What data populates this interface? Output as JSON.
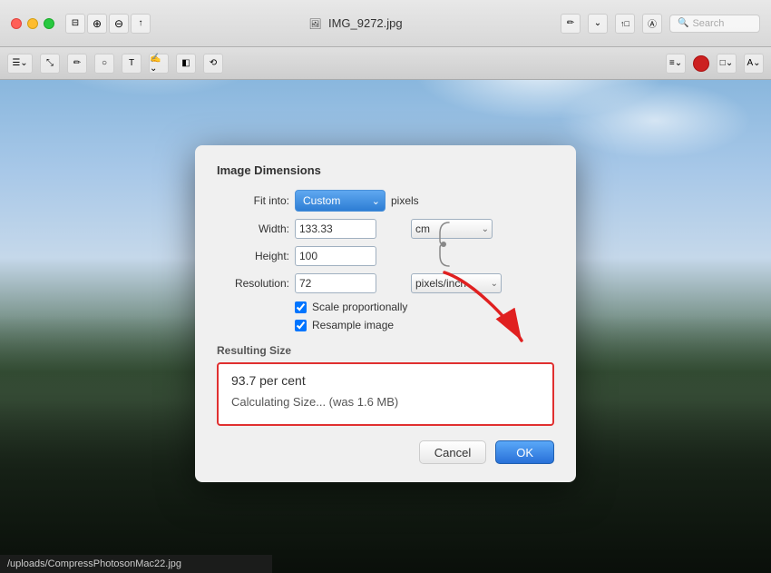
{
  "window": {
    "title": "IMG_9272.jpg",
    "title_icon": "🖼"
  },
  "titlebar": {
    "search_placeholder": "Search",
    "buttons": [
      "⊟",
      "⊡",
      "⧉"
    ]
  },
  "dialog": {
    "title": "Image Dimensions",
    "fit_into_label": "Fit into:",
    "fit_into_value": "Custom",
    "fit_into_unit": "pixels",
    "width_label": "Width:",
    "width_value": "133.33",
    "height_label": "Height:",
    "height_value": "100",
    "unit_value": "cm",
    "resolution_label": "Resolution:",
    "resolution_value": "72",
    "resolution_unit": "pixels/inch",
    "scale_label": "Scale proportionally",
    "resample_label": "Resample image",
    "resulting_label": "Resulting Size",
    "resulting_percent": "93.7 per cent",
    "resulting_calc": "Calculating Size... (was 1.6 MB)",
    "cancel_label": "Cancel",
    "ok_label": "OK"
  },
  "statusbar": {
    "path": "/uploads/CompressPhotosonMac22.jpg"
  }
}
